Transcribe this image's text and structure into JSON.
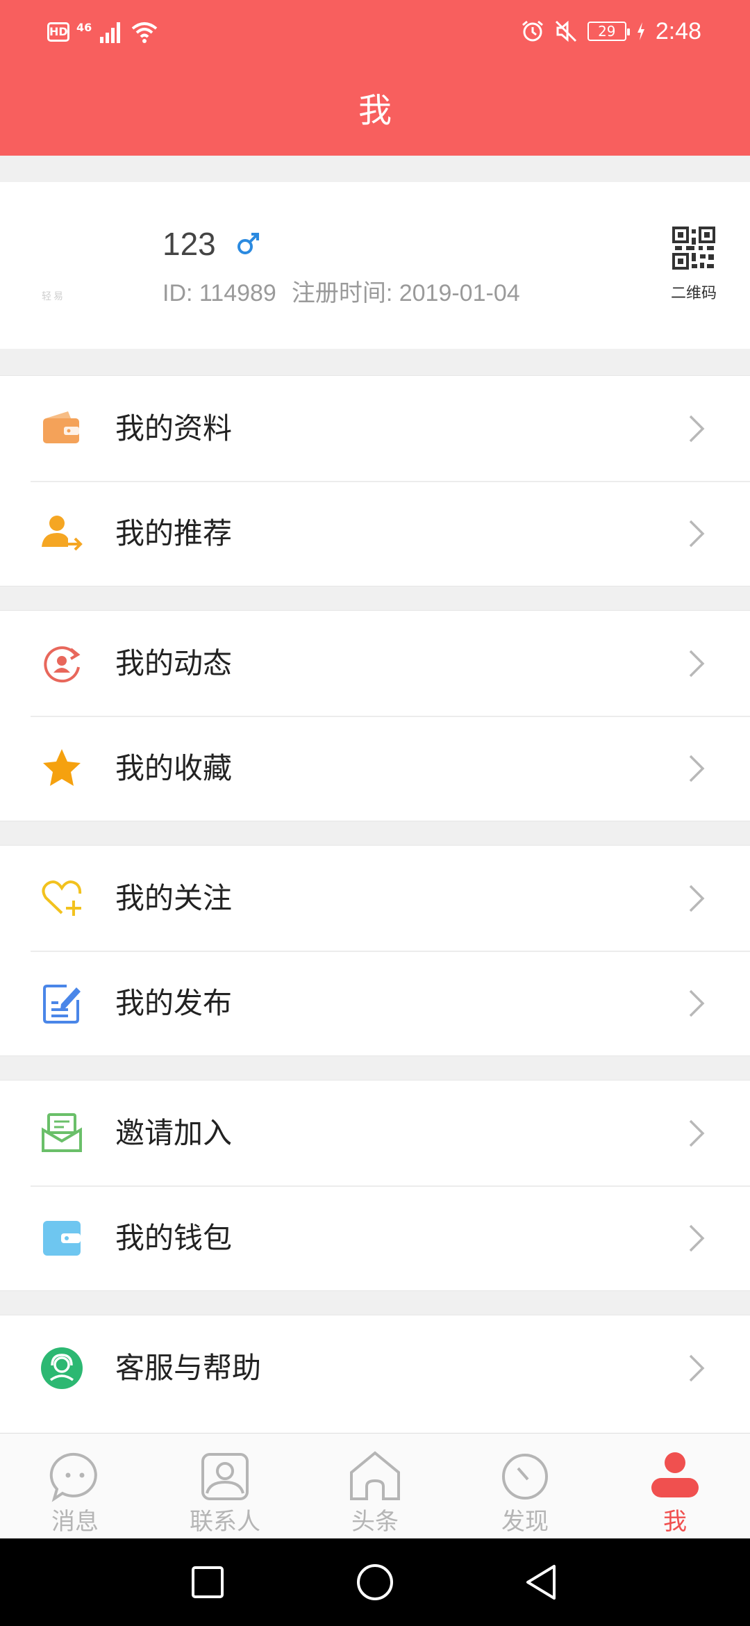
{
  "status_bar": {
    "hd_badge": "HD",
    "network": "46",
    "battery_level": "29",
    "time": "2:48"
  },
  "header": {
    "title": "我"
  },
  "profile": {
    "avatar_text": "轻易",
    "nickname": "123",
    "gender": "male",
    "id_text": "ID: 114989",
    "register_text": "注册时间: 2019-01-04",
    "qr_label": "二维码"
  },
  "menu": {
    "groups": [
      {
        "items": [
          {
            "label": "我的资料",
            "icon": "wallet-icon",
            "color": "#f4a259"
          },
          {
            "label": "我的推荐",
            "icon": "user-share-icon",
            "color": "#f5a623"
          }
        ]
      },
      {
        "items": [
          {
            "label": "我的动态",
            "icon": "refresh-user-icon",
            "color": "#e8675b"
          },
          {
            "label": "我的收藏",
            "icon": "star-icon",
            "color": "#f5a10f"
          }
        ]
      },
      {
        "items": [
          {
            "label": "我的关注",
            "icon": "heart-plus-icon",
            "color": "#f2c21e"
          },
          {
            "label": "我的发布",
            "icon": "edit-note-icon",
            "color": "#4a86e8"
          }
        ]
      },
      {
        "items": [
          {
            "label": "邀请加入",
            "icon": "mail-invite-icon",
            "color": "#6abf69"
          },
          {
            "label": "我的钱包",
            "icon": "card-wallet-icon",
            "color": "#6ec6f0"
          }
        ]
      },
      {
        "items": [
          {
            "label": "客服与帮助",
            "icon": "customer-service-icon",
            "color": "#2cb872"
          }
        ]
      }
    ]
  },
  "bottom_nav": {
    "items": [
      {
        "label": "消息",
        "icon": "chat-bubble-icon"
      },
      {
        "label": "联系人",
        "icon": "contact-card-icon"
      },
      {
        "label": "头条",
        "icon": "house-icon"
      },
      {
        "label": "发现",
        "icon": "compass-icon"
      },
      {
        "label": "我",
        "icon": "person-icon"
      }
    ],
    "active_label": "我"
  },
  "colors": {
    "brand_red": "#f85f5e",
    "active_tab": "#f0504f",
    "inactive_tab": "#b5b5b5"
  }
}
